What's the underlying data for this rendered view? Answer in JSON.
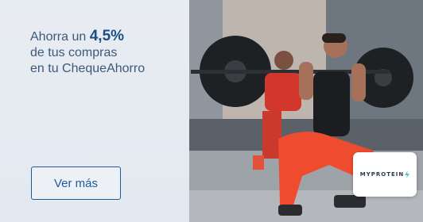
{
  "promo": {
    "line1_prefix": "Ahorra un ",
    "line1_highlight": "4,5%",
    "line2": "de tus compras",
    "line3": "en tu ChequeAhorro"
  },
  "cta": {
    "label": "Ver más"
  },
  "brand": {
    "name": "MYPROTEIN"
  },
  "colors": {
    "accent": "#1f5a9c",
    "panel": "#e8edf3",
    "pants": "#ef4b2f"
  }
}
